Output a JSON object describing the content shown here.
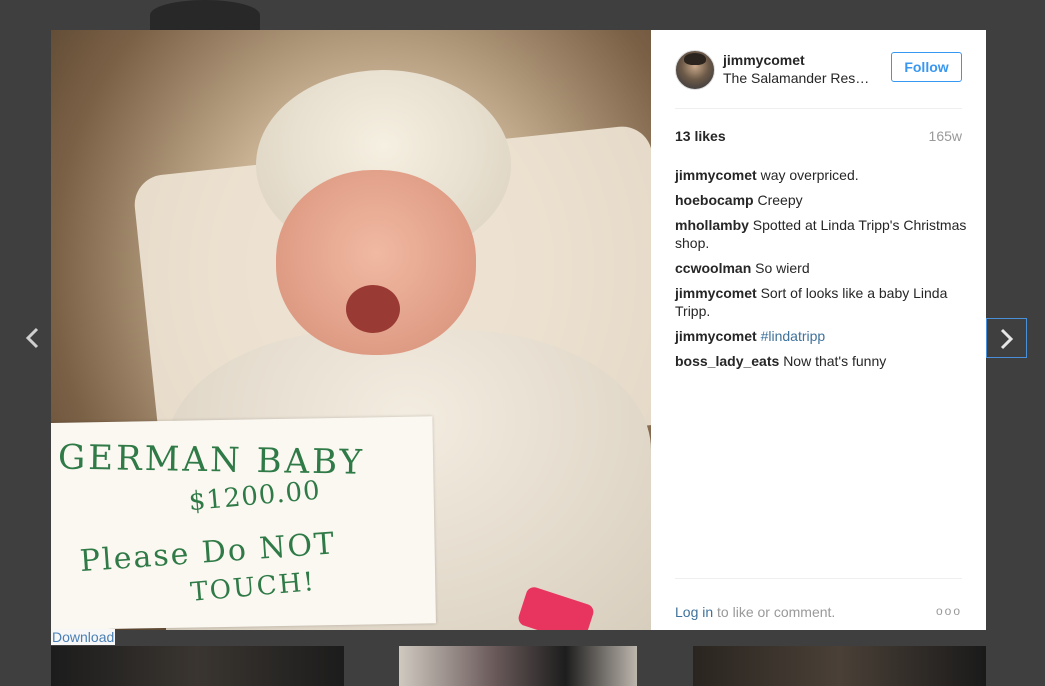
{
  "post": {
    "username": "jimmycomet",
    "location": "The Salamander Resort & Spa",
    "follow_label": "Follow",
    "likes": "13 likes",
    "age": "165w",
    "photo_sign": {
      "line1": "GERMAN BABY",
      "line2": "$1200.00",
      "line3": "Please Do NOT",
      "line4": "TOUCH!"
    },
    "comments": [
      {
        "user": "jimmycomet",
        "text": "way overpriced."
      },
      {
        "user": "hoebocamp",
        "text": "Creepy"
      },
      {
        "user": "mhollamby",
        "text": "Spotted at Linda Tripp's Christmas shop."
      },
      {
        "user": "ccwoolman",
        "text": "So wierd"
      },
      {
        "user": "jimmycomet",
        "text": "Sort of looks like a baby Linda Tripp."
      },
      {
        "user": "jimmycomet",
        "text": "",
        "tag": "#lindatripp"
      },
      {
        "user": "boss_lady_eats",
        "text": "Now that's funny"
      }
    ],
    "login_link": "Log in",
    "login_suffix": "to like or comment.",
    "more_label": "ooo"
  },
  "download_label": "Download",
  "icons": {
    "prev": "chevron-left-icon",
    "next": "chevron-right-icon"
  }
}
